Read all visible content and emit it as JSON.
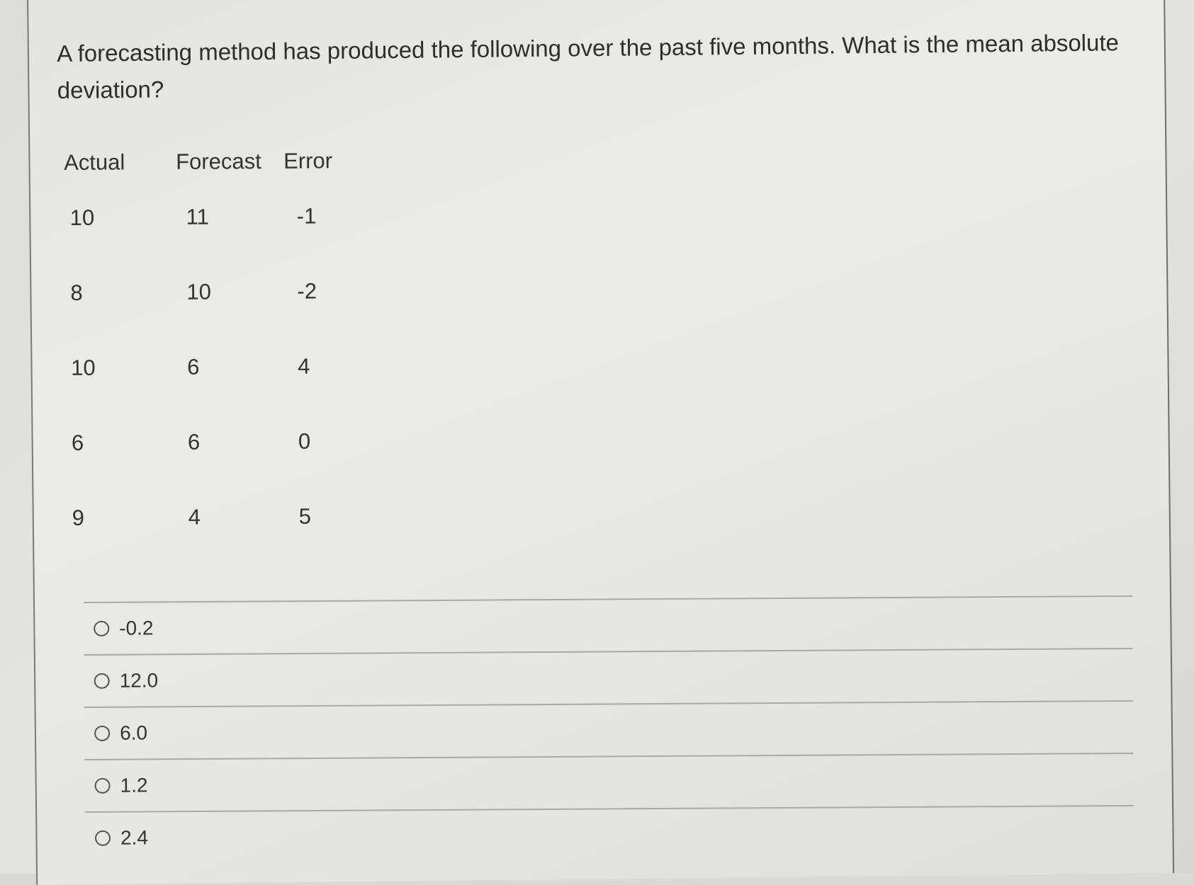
{
  "question": {
    "text": "A forecasting method has produced the following over the past five months. What is the mean absolute deviation?"
  },
  "table": {
    "headers": [
      "Actual",
      "Forecast",
      "Error"
    ],
    "rows": [
      [
        "10",
        "11",
        "-1"
      ],
      [
        "8",
        "10",
        "-2"
      ],
      [
        "10",
        "6",
        "4"
      ],
      [
        "6",
        "6",
        "0"
      ],
      [
        "9",
        "4",
        "5"
      ]
    ]
  },
  "options": [
    {
      "label": "-0.2",
      "selected": false
    },
    {
      "label": "12.0",
      "selected": false
    },
    {
      "label": "6.0",
      "selected": false
    },
    {
      "label": "1.2",
      "selected": false
    },
    {
      "label": "2.4",
      "selected": false
    }
  ]
}
